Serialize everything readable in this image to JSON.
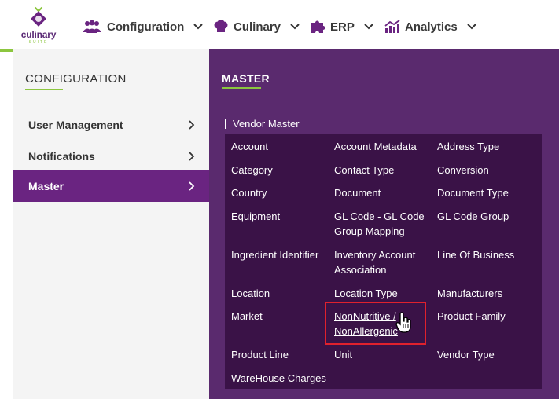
{
  "app": {
    "logo_text": "culinary",
    "logo_sub": "SUITE"
  },
  "nav": {
    "items": [
      {
        "label": "Configuration",
        "icon": "users-icon"
      },
      {
        "label": "Culinary",
        "icon": "chef-hat-icon"
      },
      {
        "label": "ERP",
        "icon": "puzzle-icon"
      },
      {
        "label": "Analytics",
        "icon": "analytics-chart-icon"
      }
    ]
  },
  "sidebar": {
    "heading": "CONFIGURATION",
    "items": [
      {
        "label": "User Management",
        "active": false
      },
      {
        "label": "Notifications",
        "active": false
      },
      {
        "label": "Master",
        "active": true
      }
    ]
  },
  "master": {
    "heading": "MASTER",
    "section_title": "Vendor Master",
    "rows": [
      [
        "Account",
        "Account Metadata",
        "Address Type"
      ],
      [
        "Category",
        "Contact Type",
        "Conversion"
      ],
      [
        "Country",
        "Document",
        "Document Type"
      ],
      [
        "Equipment",
        "GL Code - GL Code Group Mapping",
        "GL Code Group"
      ],
      [
        "Ingredient Identifier",
        "Inventory Account Association",
        "Line Of Business"
      ],
      [
        "Location",
        "Location Type",
        "Manufacturers"
      ],
      [
        "Market",
        "NonNutritive / NonAllergenic",
        "Product Family"
      ],
      [
        "Product Line",
        "Unit",
        "Vendor Type"
      ],
      [
        "WareHouse Charges"
      ]
    ],
    "hovered_item": "NonNutritive / NonAllergenic"
  },
  "colors": {
    "brand_purple": "#6a2481",
    "panel_purple": "#5a2a6e",
    "grid_dark": "#3a1247",
    "accent_green": "#8cc63f",
    "highlight_red": "#e0212d"
  }
}
